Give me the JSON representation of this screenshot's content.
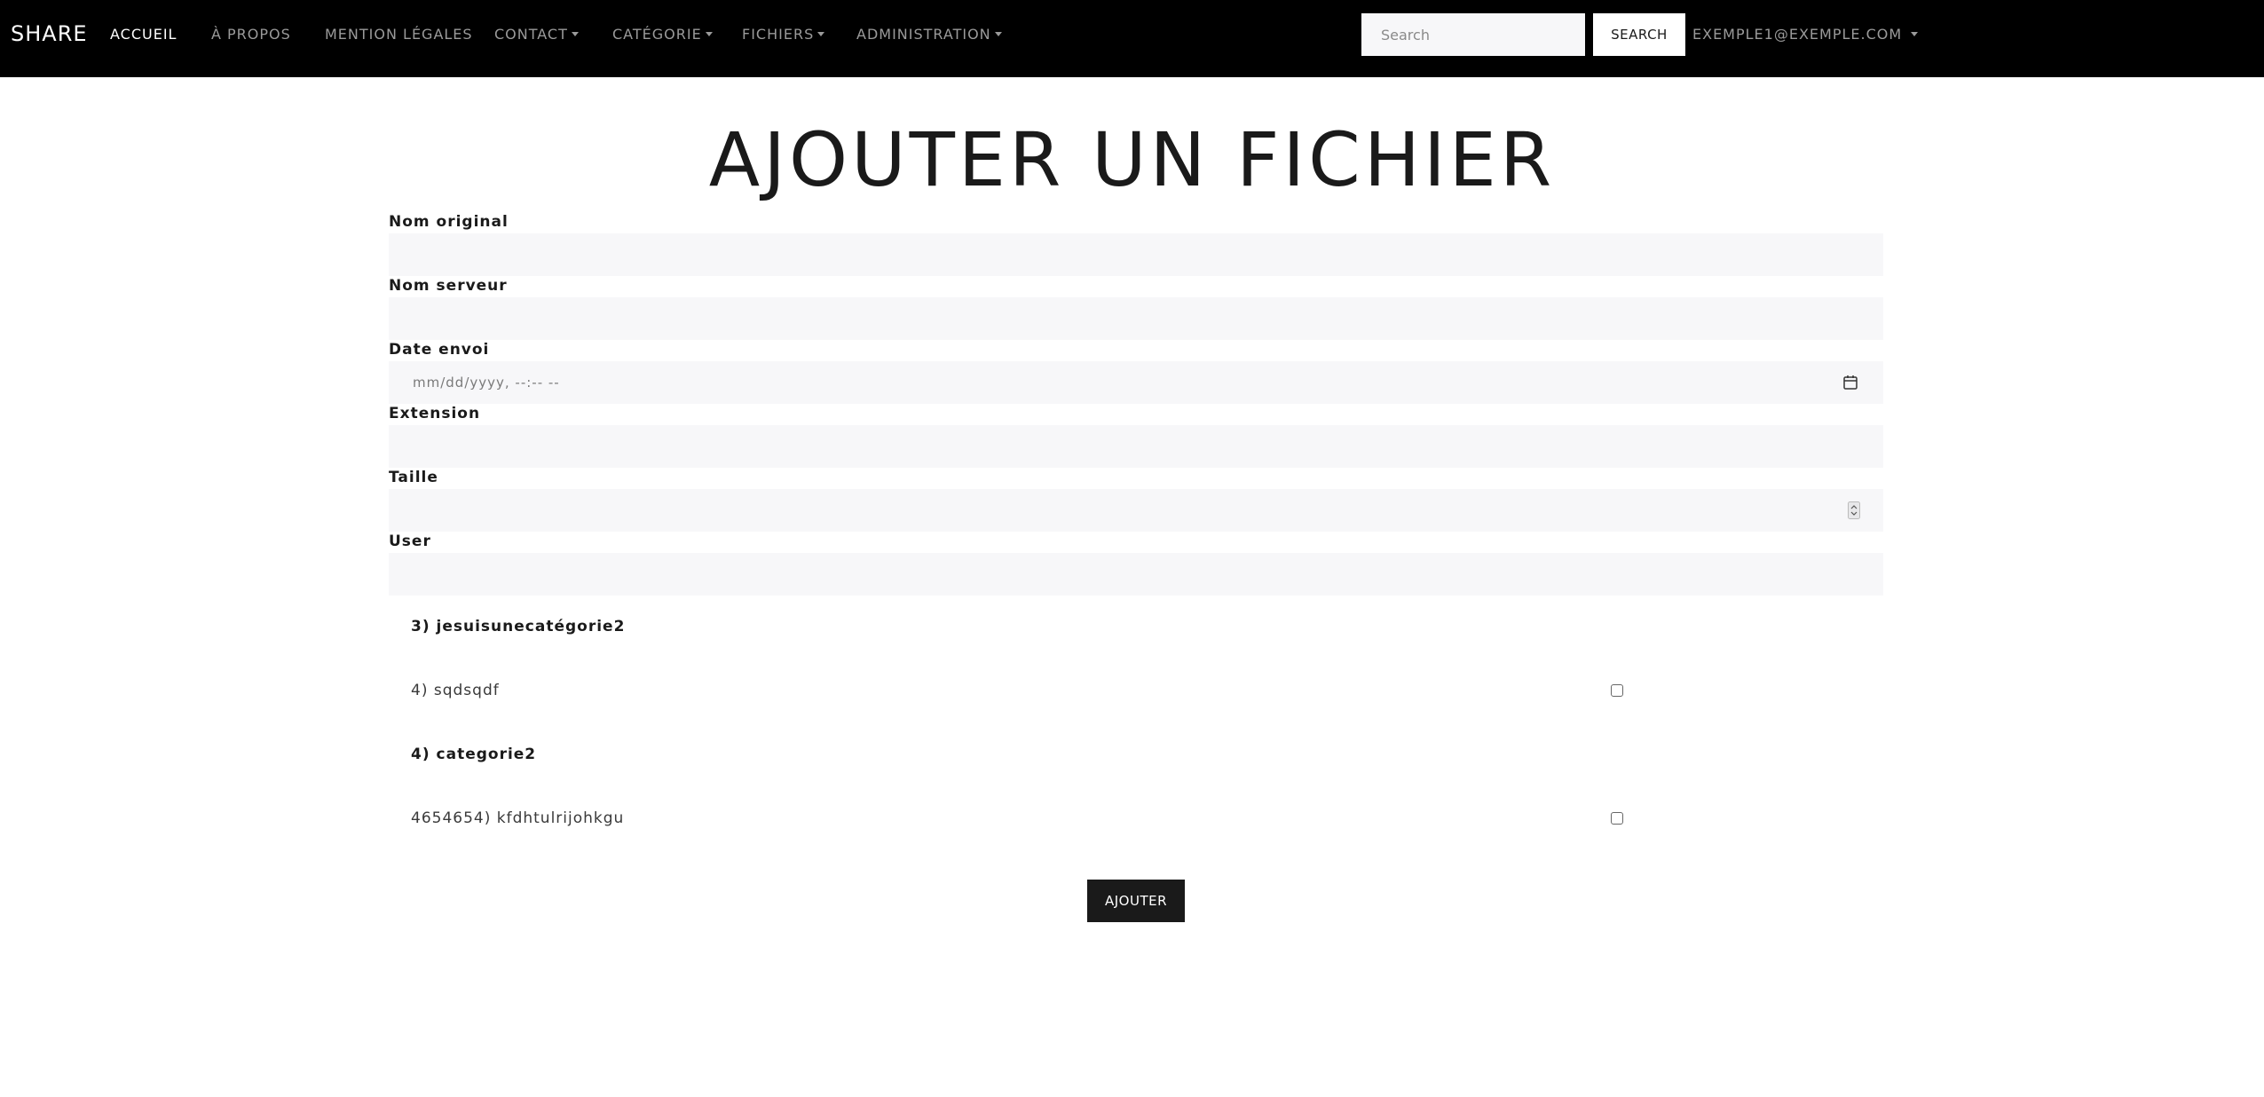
{
  "navbar": {
    "brand": "SHARE",
    "links": [
      {
        "label": "ACCUEIL",
        "dropdown": false,
        "active": true
      },
      {
        "label": "À PROPOS",
        "dropdown": false,
        "active": false
      },
      {
        "label": "MENTION LÉGALES",
        "dropdown": false,
        "active": false
      },
      {
        "label": "CONTACT",
        "dropdown": true,
        "active": false
      },
      {
        "label": "CATÉGORIE",
        "dropdown": true,
        "active": false
      },
      {
        "label": "FICHIERS",
        "dropdown": true,
        "active": false
      },
      {
        "label": "ADMINISTRATION",
        "dropdown": true,
        "active": false
      }
    ],
    "search": {
      "placeholder": "Search",
      "value": "",
      "button_label": "SEARCH"
    },
    "user": {
      "label": "EXEMPLE1@EXEMPLE.COM"
    }
  },
  "page": {
    "title": "AJOUTER UN FICHIER"
  },
  "form": {
    "fields": [
      {
        "label": "Nom original",
        "value": ""
      },
      {
        "label": "Nom serveur",
        "value": ""
      },
      {
        "label": "Date envoi",
        "placeholder": "mm/dd/yyyy, --:-- --",
        "icon": "calendar-icon"
      },
      {
        "label": "Extension",
        "value": ""
      },
      {
        "label": "Taille",
        "value": "",
        "icon": "spinner-icon"
      },
      {
        "label": "User",
        "value": ""
      }
    ],
    "categories": [
      {
        "header": "3) jesuisunecatégorie2",
        "items": [
          {
            "label": "4) sqdsqdf",
            "checked": false
          }
        ]
      },
      {
        "header": "4) categorie2",
        "items": [
          {
            "label": "4654654) kfdhtulrijohkgu",
            "checked": false
          }
        ]
      }
    ],
    "submit_label": "AJOUTER"
  },
  "colors": {
    "navbar_bg": "#000000",
    "input_bg": "#f7f7f9",
    "button_bg": "#1a1a1a",
    "nav_text": "#9a9a9a"
  }
}
